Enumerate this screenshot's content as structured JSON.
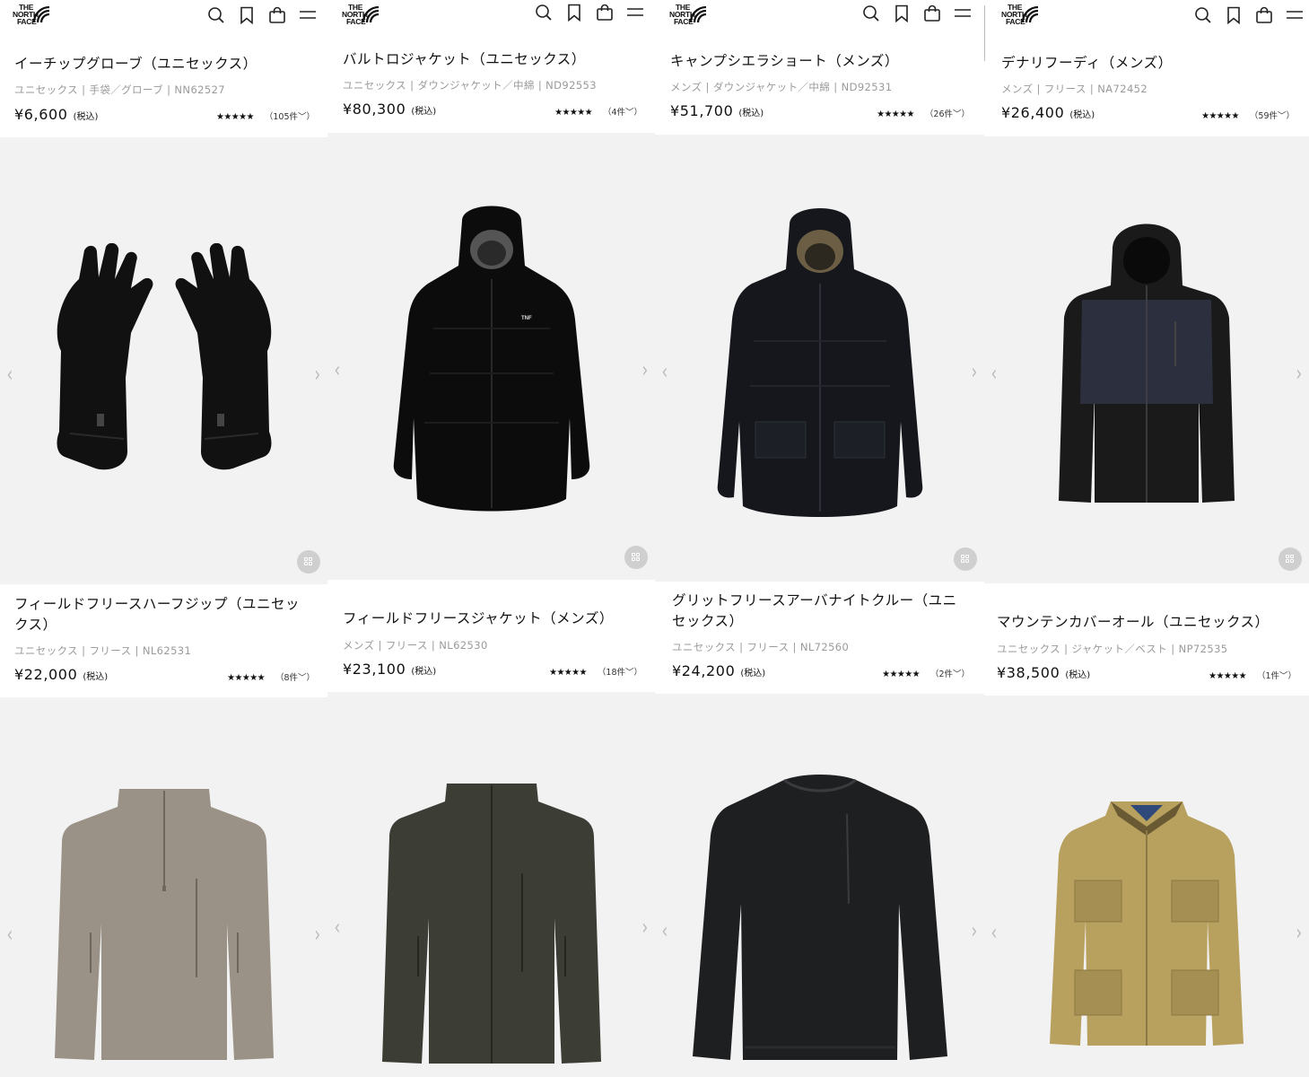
{
  "brand": {
    "logo_lines": [
      "THE",
      "NORTH",
      "FACE"
    ]
  },
  "header_icons": [
    "search-icon",
    "bookmark-icon",
    "cart-icon",
    "menu-icon"
  ],
  "products": [
    {
      "title": "イーチップグローブ（ユニセックス）",
      "meta": "ユニセックス | 手袋／グローブ | NN62527",
      "price": "¥6,600",
      "tax": "(税込)",
      "stars": "★★★★★",
      "rating": 4.5,
      "reviews": "（105件﹀）",
      "image": "glove-pair",
      "color": "#101010"
    },
    {
      "title": "バルトロジャケット（ユニセックス）",
      "meta": "ユニセックス | ダウンジャケット／中綿 | ND92553",
      "price": "¥80,300",
      "tax": "(税込)",
      "stars": "★★★★★",
      "rating": 5,
      "reviews": "（4件﹀）",
      "image": "down-jacket-hood",
      "color": "#0c0c0c"
    },
    {
      "title": "キャンプシエラショート（メンズ）",
      "meta": "メンズ | ダウンジャケット／中綿 | ND92531",
      "price": "¥51,700",
      "tax": "(税込)",
      "stars": "★★★★★",
      "rating": 5,
      "reviews": "（26件﹀）",
      "image": "puffer-hood-pockets",
      "color": "#15171c"
    },
    {
      "title": "デナリフーディ（メンズ）",
      "meta": "メンズ | フリース | NA72452",
      "price": "¥26,400",
      "tax": "(税込)",
      "stars": "★★★★★",
      "rating": 4.5,
      "reviews": "（59件﹀）",
      "image": "fleece-hoodie",
      "color": "#1a1a1a"
    },
    {
      "title": "フィールドフリースハーフジップ（ユニセックス）",
      "meta": "ユニセックス | フリース | NL62531",
      "price": "¥22,000",
      "tax": "(税込)",
      "stars": "★★★★★",
      "rating": 5,
      "reviews": "（8件﹀）",
      "image": "half-zip-fleece",
      "color": "#9a9286"
    },
    {
      "title": "フィールドフリースジャケット（メンズ）",
      "meta": "メンズ | フリース | NL62530",
      "price": "¥23,100",
      "tax": "(税込)",
      "stars": "★★★★★",
      "rating": 4.5,
      "reviews": "（18件﹀）",
      "image": "fleece-jacket",
      "color": "#3c3e36"
    },
    {
      "title": "グリットフリースアーバナイトクルー（ユニセックス）",
      "meta": "ユニセックス | フリース | NL72560",
      "price": "¥24,200",
      "tax": "(税込)",
      "stars": "★★★★★",
      "rating": 4.5,
      "reviews": "（2件﹀）",
      "image": "crew-pullover",
      "color": "#1e1f21"
    },
    {
      "title": "マウンテンカバーオール（ユニセックス）",
      "meta": "ユニセックス | ジャケット／ベスト | NP72535",
      "price": "¥38,500",
      "tax": "(税込)",
      "stars": "★★★★★",
      "rating": 5,
      "reviews": "（1件﹀）",
      "image": "coverall-jacket",
      "color": "#b8a05e"
    }
  ]
}
